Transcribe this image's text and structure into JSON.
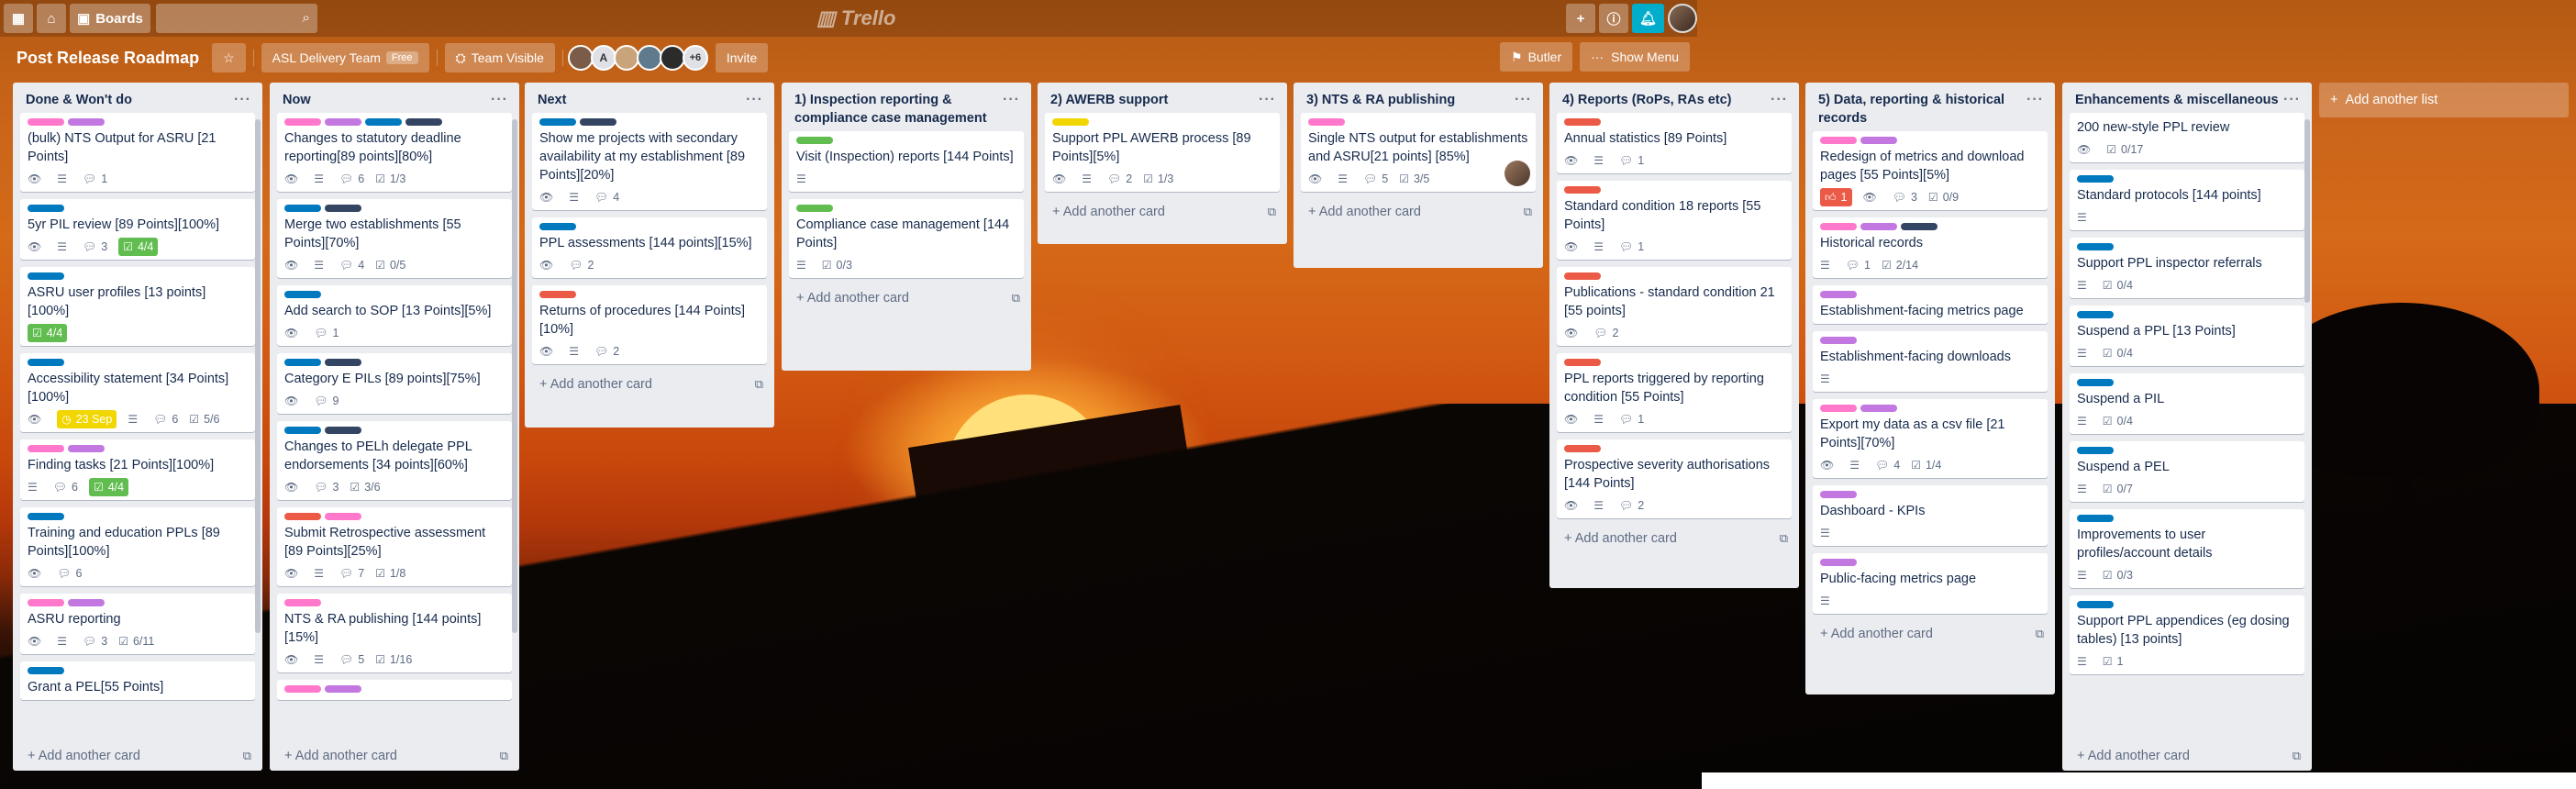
{
  "header": {
    "boards_label": "Boards",
    "logo": "Trello"
  },
  "board": {
    "title": "Post Release Roadmap",
    "team": "ASL Delivery Team",
    "team_badge": "Free",
    "visibility": "Team Visible",
    "member_initial": "A",
    "more_members": "+6",
    "invite": "Invite",
    "butler": "Butler",
    "show_menu": "Show Menu"
  },
  "add_card_label": "Add another card",
  "add_list_label": "Add another list",
  "lists": [
    {
      "title": "Done & Won't do",
      "cards": [
        {
          "labels": [
            "pink",
            "purple"
          ],
          "title": "(bulk) NTS Output for ASRU [21 Points]",
          "badges": [
            {
              "t": "watch"
            },
            {
              "t": "desc"
            },
            {
              "t": "comments",
              "v": "1"
            }
          ]
        },
        {
          "labels": [
            "blue"
          ],
          "title": "5yr PIL review [89 Points][100%]",
          "badges": [
            {
              "t": "watch"
            },
            {
              "t": "desc"
            },
            {
              "t": "comments",
              "v": "3"
            },
            {
              "t": "checkdone",
              "v": "4/4"
            }
          ]
        },
        {
          "labels": [
            "blue"
          ],
          "title": "ASRU user profiles [13 points] [100%]",
          "badges": [
            {
              "t": "checkdone",
              "v": "4/4"
            }
          ]
        },
        {
          "labels": [
            "blue"
          ],
          "title": "Accessibility statement [34 Points] [100%]",
          "badges": [
            {
              "t": "watch"
            },
            {
              "t": "due",
              "v": "23 Sep"
            },
            {
              "t": "desc"
            },
            {
              "t": "comments",
              "v": "6"
            },
            {
              "t": "check",
              "v": "5/6"
            }
          ]
        },
        {
          "labels": [
            "pink",
            "purple"
          ],
          "title": "Finding tasks [21 Points][100%]",
          "badges": [
            {
              "t": "desc"
            },
            {
              "t": "comments",
              "v": "6"
            },
            {
              "t": "checkdone",
              "v": "4/4"
            }
          ]
        },
        {
          "labels": [
            "blue"
          ],
          "title": "Training and education PPLs [89 Points][100%]",
          "badges": [
            {
              "t": "watch"
            },
            {
              "t": "comments",
              "v": "6"
            }
          ]
        },
        {
          "labels": [
            "pink",
            "purple"
          ],
          "title": "ASRU reporting",
          "badges": [
            {
              "t": "watch"
            },
            {
              "t": "desc"
            },
            {
              "t": "comments",
              "v": "3"
            },
            {
              "t": "check",
              "v": "6/11"
            }
          ]
        },
        {
          "labels": [
            "blue"
          ],
          "title": "Grant a PEL[55 Points]",
          "badges": []
        }
      ]
    },
    {
      "title": "Now",
      "cards": [
        {
          "labels": [
            "pink",
            "purple",
            "blue",
            "black"
          ],
          "title": "Changes to statutory deadline reporting[89 points][80%]",
          "badges": [
            {
              "t": "watch"
            },
            {
              "t": "desc"
            },
            {
              "t": "comments",
              "v": "6"
            },
            {
              "t": "check",
              "v": "1/3"
            }
          ]
        },
        {
          "labels": [
            "blue",
            "black"
          ],
          "title": "Merge two establishments [55 Points][70%]",
          "badges": [
            {
              "t": "watch"
            },
            {
              "t": "desc"
            },
            {
              "t": "comments",
              "v": "4"
            },
            {
              "t": "check",
              "v": "0/5"
            }
          ]
        },
        {
          "labels": [
            "blue"
          ],
          "title": "Add search to SOP [13 Points][5%]",
          "badges": [
            {
              "t": "watch"
            },
            {
              "t": "comments",
              "v": "1"
            }
          ]
        },
        {
          "labels": [
            "blue",
            "black"
          ],
          "title": "Category E PILs [89 points][75%]",
          "badges": [
            {
              "t": "watch"
            },
            {
              "t": "comments",
              "v": "9"
            }
          ]
        },
        {
          "labels": [
            "blue",
            "black"
          ],
          "title": "Changes to PELh delegate PPL endorsements [34 points][60%]",
          "badges": [
            {
              "t": "watch"
            },
            {
              "t": "comments",
              "v": "3"
            },
            {
              "t": "check",
              "v": "3/6"
            }
          ]
        },
        {
          "labels": [
            "red",
            "pink"
          ],
          "title": "Submit Retrospective assessment [89 Points][25%]",
          "badges": [
            {
              "t": "watch"
            },
            {
              "t": "desc"
            },
            {
              "t": "comments",
              "v": "7"
            },
            {
              "t": "check",
              "v": "1/8"
            }
          ]
        },
        {
          "labels": [
            "pink"
          ],
          "title": "NTS & RA publishing [144 points] [15%]",
          "badges": [
            {
              "t": "watch"
            },
            {
              "t": "desc"
            },
            {
              "t": "comments",
              "v": "5"
            },
            {
              "t": "check",
              "v": "1/16"
            }
          ]
        },
        {
          "labels": [
            "pink",
            "purple"
          ],
          "title": "",
          "badges": []
        }
      ]
    },
    {
      "title": "Next",
      "cards": [
        {
          "labels": [
            "blue",
            "black"
          ],
          "title": "Show me projects with secondary availability at my establishment [89 Points][20%]",
          "badges": [
            {
              "t": "watch"
            },
            {
              "t": "desc"
            },
            {
              "t": "comments",
              "v": "4"
            }
          ]
        },
        {
          "labels": [
            "blue"
          ],
          "title": "PPL assessments [144 points][15%]",
          "badges": [
            {
              "t": "watch"
            },
            {
              "t": "comments",
              "v": "2"
            }
          ]
        },
        {
          "labels": [
            "red"
          ],
          "title": "Returns of procedures [144 Points] [10%]",
          "badges": [
            {
              "t": "watch"
            },
            {
              "t": "desc"
            },
            {
              "t": "comments",
              "v": "2"
            }
          ]
        }
      ]
    },
    {
      "title": "1) Inspection reporting & compliance case management",
      "cards": [
        {
          "labels": [
            "green"
          ],
          "title": "Visit (Inspection) reports [144 Points]",
          "badges": [
            {
              "t": "desc"
            }
          ]
        },
        {
          "labels": [
            "green"
          ],
          "title": "Compliance case management [144 Points]",
          "badges": [
            {
              "t": "desc"
            },
            {
              "t": "check",
              "v": "0/3"
            }
          ]
        }
      ]
    },
    {
      "title": "2) AWERB support",
      "cards": [
        {
          "labels": [
            "yellow"
          ],
          "title": "Support PPL AWERB process [89 Points][5%]",
          "badges": [
            {
              "t": "watch"
            },
            {
              "t": "desc"
            },
            {
              "t": "comments",
              "v": "2"
            },
            {
              "t": "check",
              "v": "1/3"
            }
          ]
        }
      ]
    },
    {
      "title": "3) NTS & RA publishing",
      "cards": [
        {
          "labels": [
            "pink"
          ],
          "title": "Single NTS output for establishments and ASRU[21 points] [85%]",
          "badges": [
            {
              "t": "watch"
            },
            {
              "t": "desc"
            },
            {
              "t": "comments",
              "v": "5"
            },
            {
              "t": "check",
              "v": "3/5"
            }
          ],
          "member": true
        }
      ]
    },
    {
      "title": "4) Reports (RoPs, RAs etc)",
      "cards": [
        {
          "labels": [
            "red"
          ],
          "title": "Annual statistics [89 Points]",
          "badges": [
            {
              "t": "watch"
            },
            {
              "t": "desc"
            },
            {
              "t": "comments",
              "v": "1"
            }
          ]
        },
        {
          "labels": [
            "red"
          ],
          "title": "Standard condition 18 reports [55 Points]",
          "badges": [
            {
              "t": "watch"
            },
            {
              "t": "desc"
            },
            {
              "t": "comments",
              "v": "1"
            }
          ]
        },
        {
          "labels": [
            "red"
          ],
          "title": "Publications - standard condition 21 [55 points]",
          "badges": [
            {
              "t": "watch"
            },
            {
              "t": "comments",
              "v": "2"
            }
          ]
        },
        {
          "labels": [
            "red"
          ],
          "title": "PPL reports triggered by reporting condition [55 Points]",
          "badges": [
            {
              "t": "watch"
            },
            {
              "t": "desc"
            },
            {
              "t": "comments",
              "v": "1"
            }
          ]
        },
        {
          "labels": [
            "red"
          ],
          "title": "Prospective severity authorisations [144 Points]",
          "badges": [
            {
              "t": "watch"
            },
            {
              "t": "desc"
            },
            {
              "t": "comments",
              "v": "2"
            }
          ]
        }
      ]
    },
    {
      "title": "5) Data, reporting & historical records",
      "cards": [
        {
          "labels": [
            "pink",
            "purple"
          ],
          "title": "Redesign of metrics and download pages [55 Points][5%]",
          "badges": [
            {
              "t": "votes",
              "v": "1"
            },
            {
              "t": "watch"
            },
            {
              "t": "comments",
              "v": "3"
            },
            {
              "t": "check",
              "v": "0/9"
            }
          ]
        },
        {
          "labels": [
            "pink",
            "purple",
            "black"
          ],
          "title": "Historical records",
          "badges": [
            {
              "t": "desc"
            },
            {
              "t": "comments",
              "v": "1"
            },
            {
              "t": "check",
              "v": "2/14"
            }
          ]
        },
        {
          "labels": [
            "purple"
          ],
          "title": "Establishment-facing metrics page",
          "badges": []
        },
        {
          "labels": [
            "purple"
          ],
          "title": "Establishment-facing downloads",
          "badges": [
            {
              "t": "desc"
            }
          ]
        },
        {
          "labels": [
            "pink",
            "purple"
          ],
          "title": "Export my data as a csv file [21 Points][70%]",
          "badges": [
            {
              "t": "watch"
            },
            {
              "t": "desc"
            },
            {
              "t": "comments",
              "v": "4"
            },
            {
              "t": "check",
              "v": "1/4"
            }
          ]
        },
        {
          "labels": [
            "purple"
          ],
          "title": "Dashboard - KPIs",
          "badges": [
            {
              "t": "desc"
            }
          ]
        },
        {
          "labels": [
            "purple"
          ],
          "title": "Public-facing metrics page",
          "badges": [
            {
              "t": "desc"
            }
          ]
        }
      ]
    },
    {
      "title": "Enhancements & miscellaneous",
      "cards": [
        {
          "labels": [],
          "title": "200 new-style PPL review",
          "badges": [
            {
              "t": "watch"
            },
            {
              "t": "check",
              "v": "0/17"
            }
          ]
        },
        {
          "labels": [
            "blue"
          ],
          "title": "Standard protocols [144 points]",
          "badges": [
            {
              "t": "desc"
            }
          ]
        },
        {
          "labels": [
            "blue"
          ],
          "title": "Support PPL inspector referrals",
          "badges": [
            {
              "t": "desc"
            },
            {
              "t": "check",
              "v": "0/4"
            }
          ]
        },
        {
          "labels": [
            "blue"
          ],
          "title": "Suspend a PPL [13 Points]",
          "badges": [
            {
              "t": "desc"
            },
            {
              "t": "check",
              "v": "0/4"
            }
          ]
        },
        {
          "labels": [
            "blue"
          ],
          "title": "Suspend a PIL",
          "badges": [
            {
              "t": "desc"
            },
            {
              "t": "check",
              "v": "0/4"
            }
          ]
        },
        {
          "labels": [
            "blue"
          ],
          "title": "Suspend a PEL",
          "badges": [
            {
              "t": "desc"
            },
            {
              "t": "check",
              "v": "0/7"
            }
          ]
        },
        {
          "labels": [
            "blue"
          ],
          "title": "Improvements to user profiles/account details",
          "badges": [
            {
              "t": "desc"
            },
            {
              "t": "check",
              "v": "0/3"
            }
          ]
        },
        {
          "labels": [
            "blue"
          ],
          "title": "Support PPL appendices (eg dosing tables) [13 points]",
          "badges": [
            {
              "t": "desc"
            },
            {
              "t": "check",
              "v": "1"
            }
          ]
        }
      ]
    }
  ]
}
